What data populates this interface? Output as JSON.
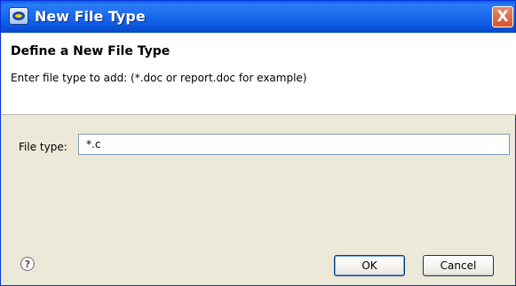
{
  "window": {
    "title": "New File Type",
    "close_glyph": "X"
  },
  "header": {
    "title": "Define a New File Type",
    "message": "Enter file type to add: (*.doc or report.doc for example)"
  },
  "form": {
    "file_type_label": "File type:",
    "file_type_value": "*.c"
  },
  "footer": {
    "help_glyph": "?",
    "ok_label": "OK",
    "cancel_label": "Cancel"
  },
  "icons": {
    "app": "eclipse-app-icon",
    "help": "help-icon",
    "close": "close-icon"
  },
  "colors": {
    "titlebar": "#0a56dd",
    "close_button": "#d8512c",
    "dialog_bg": "#ece9d8",
    "header_bg": "#ffffff"
  }
}
